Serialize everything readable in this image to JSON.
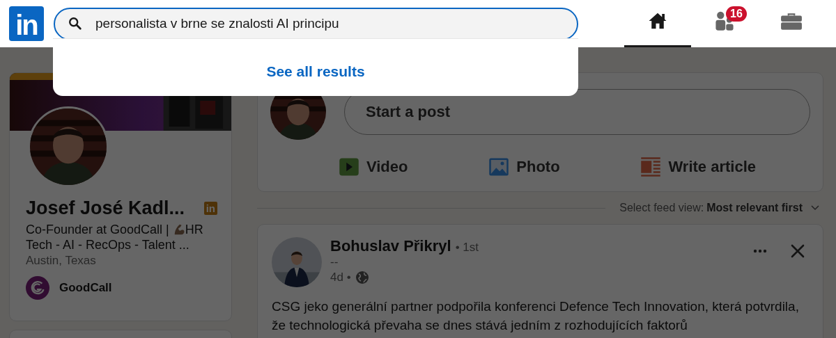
{
  "header": {
    "logo": "in",
    "search": {
      "value": "personalista v brne se znalosti AI principu"
    },
    "nav": [
      {
        "kind": "home",
        "selected": true
      },
      {
        "kind": "network",
        "selected": false,
        "badge": "16"
      },
      {
        "kind": "jobs",
        "selected": false
      }
    ]
  },
  "search_dropdown": {
    "link": "See all results"
  },
  "profile_card": {
    "name": "Josef José Kadl...",
    "badge": "in",
    "headline_before": "Co-Founder at GoodCall |",
    "headline_after": "HR",
    "headline_line2": "Tech - AI - RecOps - Talent ...",
    "location": "Austin, Texas",
    "company": "GoodCall"
  },
  "composer": {
    "placeholder": "Start a post",
    "actions": [
      {
        "kind": "video",
        "label": "Video"
      },
      {
        "label": "Photo"
      },
      {
        "kind": "article",
        "label": "Write article"
      }
    ]
  },
  "feed_sort": {
    "label": "Select feed view:",
    "value": "Most relevant first"
  },
  "post": {
    "author": "Bohuslav Přikryl",
    "degree": "• 1st",
    "subtitle": "--",
    "age": "4d •",
    "text": "CSG jeko generální partner podpořila konferenci Defence Tech Innovation, která potvrdila, že technologická převaha se dnes stává jedním z rozhodujících faktorů"
  }
}
